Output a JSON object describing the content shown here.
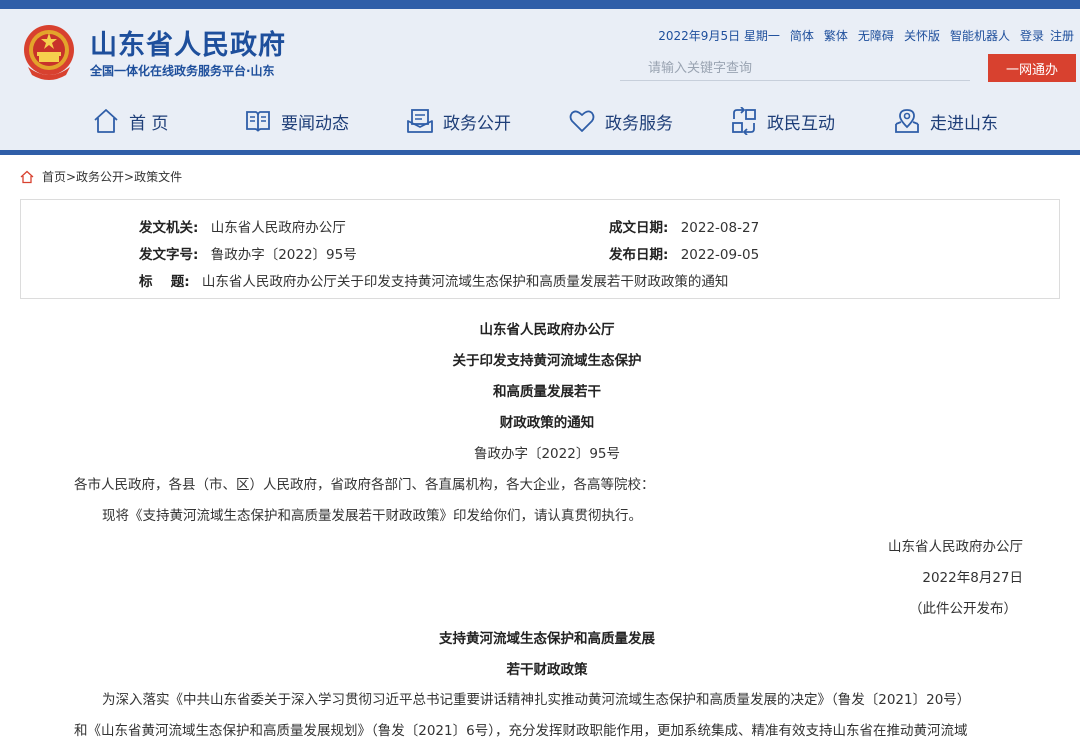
{
  "header": {
    "site_title": "山东省人民政府",
    "site_subtitle": "全国一体化在线政务服务平台·山东",
    "util_links": [
      "2022年9月5日 星期一",
      "简体",
      "繁体",
      "无障碍",
      "关怀版",
      "智能机器人",
      "登录",
      "注册"
    ],
    "search_placeholder": "请输入关键字查询",
    "yiwang_label": "一网通办"
  },
  "nav": {
    "items": [
      "首 页",
      "要闻动态",
      "政务公开",
      "政务服务",
      "政民互动",
      "走进山东"
    ]
  },
  "breadcrumb": "首页>政务公开>政策文件",
  "meta": {
    "issuer_label": "发文机关:",
    "issuer": "山东省人民政府办公厅",
    "docno_label": "发文字号:",
    "docno": "鲁政办字〔2022〕95号",
    "title_label": "标　 题:",
    "title": "山东省人民政府办公厅关于印发支持黄河流域生态保护和高质量发展若干财政政策的通知",
    "created_label": "成文日期:",
    "created": "2022-08-27",
    "published_label": "发布日期:",
    "published": "2022-09-05"
  },
  "doc": {
    "title_lines": [
      "山东省人民政府办公厅",
      "关于印发支持黄河流域生态保护",
      "和高质量发展若干",
      "财政政策的通知"
    ],
    "docno": "鲁政办字〔2022〕95号",
    "addressee": "各市人民政府，各县（市、区）人民政府，省政府各部门、各直属机构，各大企业，各高等院校：",
    "body1": "现将《支持黄河流域生态保护和高质量发展若干财政政策》印发给你们，请认真贯彻执行。",
    "sign_org": "山东省人民政府办公厅",
    "sign_date": "2022年8月27日",
    "sign_note": "（此件公开发布）",
    "policy_title_lines": [
      "支持黄河流域生态保护和高质量发展",
      "若干财政政策"
    ],
    "para1": "为深入落实《中共山东省委关于深入学习贯彻习近平总书记重要讲话精神扎实推动黄河流域生态保护和高质量发展的决定》（鲁发〔2021〕20号）",
    "para2": "和《山东省黄河流域生态保护和高质量发展规划》（鲁发〔2021〕6号），充分发挥财政职能作用，更加系统集成、精准有效支持山东省在推动黄河流域"
  },
  "colors": {
    "brand_blue": "#1e4f9c",
    "bar_blue": "#2f5ea8",
    "header_bg": "#e9eef6",
    "action_red": "#d8412f"
  }
}
